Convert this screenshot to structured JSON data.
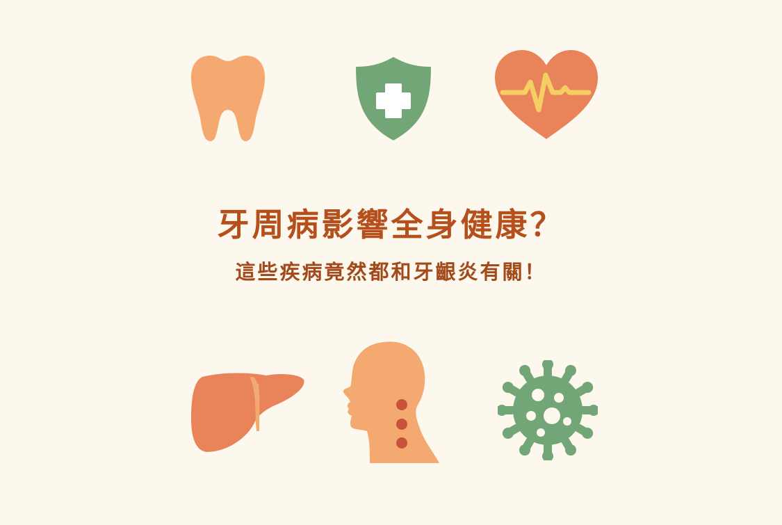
{
  "headline": {
    "title": "牙周病影響全身健康？",
    "subtitle": "這些疾病竟然都和牙齦炎有關！"
  },
  "icons": [
    "tooth-icon",
    "shield-plus-icon",
    "heart-pulse-icon",
    "liver-icon",
    "head-neck-icon",
    "virus-icon"
  ],
  "colors": {
    "background": "#fdf8ee",
    "title": "#b5501c",
    "subtitle": "#a34a1c",
    "peach": "#f3a970",
    "coral": "#e8835a",
    "green": "#73a676",
    "yellow": "#f6cf62",
    "red_dot": "#c9523a"
  }
}
